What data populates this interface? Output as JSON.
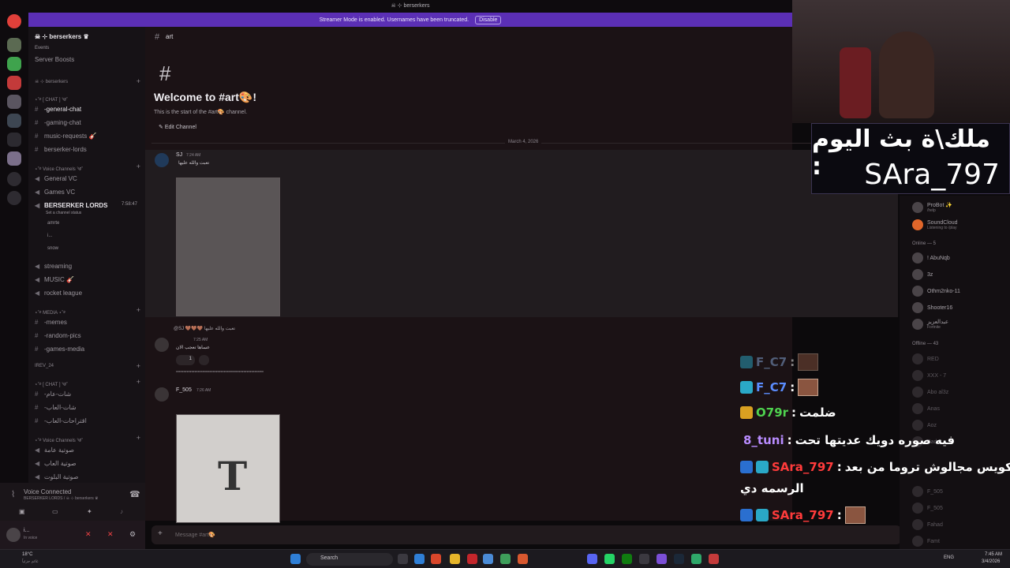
{
  "window": {
    "title": "☠ ⊹ berserkers"
  },
  "banner": {
    "text": "Streamer Mode is enabled. Usernames have been truncated.",
    "disable": "Disable"
  },
  "server": {
    "name": "☠ ⊹ berserkers ♛"
  },
  "sidebar": {
    "top_items": [
      "Events",
      "Server Boosts"
    ],
    "categories": [
      "☠ ⊹ berserkers",
      "⋆˚࿔ [ CHAT ] ༄˚",
      "⋆˚࿔ Voice Channels ༄˚",
      "⋆˚࿔ MEDIA ⋆˚࿔",
      "IREV_24",
      "⋆˚࿔ [ CHAT ] ༄˚",
      "⋆˚࿔ Voice Channels ༄˚"
    ],
    "channels": [
      "-general-chat",
      "-gaming-chat",
      "music-requests 🎸",
      "berserker-lords",
      "General VC",
      "Games VC",
      "BERSERKER LORDS",
      "streaming",
      "MUSIC 🎸",
      "rocket league",
      "-memes",
      "-random-pics",
      "-games-media",
      "-شات-عام",
      "-شات-العاب",
      "-اقتراحات-العاب",
      "صوتية عامة",
      "صوتية العاب",
      "صوتية البلوت"
    ],
    "voice_channel_status": "Set a channel status",
    "voice_timer": "7:58:47",
    "voice_users": [
      "amrte",
      "i...",
      "snow"
    ]
  },
  "voice": {
    "status": "Voice Connected",
    "where": "BERSERKER LORDS / ☠ ⊹ berserkers ♛"
  },
  "user": {
    "name": "i...",
    "status": "In voice"
  },
  "chat": {
    "channel": "art",
    "welcome_title": "Welcome to #art🎨!",
    "welcome_sub": "This is the start of the #art🎨 channel.",
    "edit_channel": "Edit Channel",
    "date_divider": "March 4, 2026",
    "messages": [
      {
        "author": "SJ",
        "time": "7:24 AM",
        "text": "تعبت والله عليها"
      },
      {
        "reply": "@SJ 🤎🤎🤎 تعبت والله عليها",
        "time": "7:25 AM",
        "text": "عساها تعجب الان",
        "reaction": "1"
      },
      {
        "author": "F_505",
        "time": "7:26 AM",
        "text": ""
      }
    ],
    "dots_line": "*********************************************************",
    "composer_placeholder": "Message #art🎨"
  },
  "overlay": {
    "line1": "ملك\\ة بث اليوم :",
    "line2": "SAra_797"
  },
  "stream_chat": [
    {
      "user": "F_C7",
      "text": ""
    },
    {
      "user": "F_C7",
      "text": ""
    },
    {
      "user": "O79r",
      "text": "ضلمت"
    },
    {
      "user": "8_tuni",
      "text": "فيه صوره دويك عديتها تحت"
    },
    {
      "user": "SAra_797",
      "text": "كويس مجالوش تروما من بعد"
    },
    {
      "user": "",
      "text": "الرسمه دي"
    },
    {
      "user": "SAra_797",
      "text": ""
    }
  ],
  "members": {
    "apps": [
      {
        "name": "ProBot ✨",
        "sub": "/help"
      },
      {
        "name": "SoundCloud",
        "sub": "Listening to /play"
      }
    ],
    "online_header": "Online — 5",
    "online": [
      {
        "name": "! AbuNqb"
      },
      {
        "name": "3z"
      },
      {
        "name": "Othm2nko-11"
      },
      {
        "name": "Shooter16"
      },
      {
        "name": "عبدالعزيز",
        "sub": "Fortnite"
      }
    ],
    "offline_header": "Offline — 43",
    "offline": [
      "RED",
      "XXX - 7",
      "Abo al3z",
      "Anas",
      "Aoz",
      "Bader",
      "F_505",
      "F_505",
      "Fahad",
      "Famt"
    ]
  },
  "taskbar": {
    "weather": "18°C",
    "weather_sub": "غائم جزئياً",
    "search": "Search",
    "lang": "ENG",
    "time": "7:45 AM",
    "date": "3/4/2026"
  }
}
